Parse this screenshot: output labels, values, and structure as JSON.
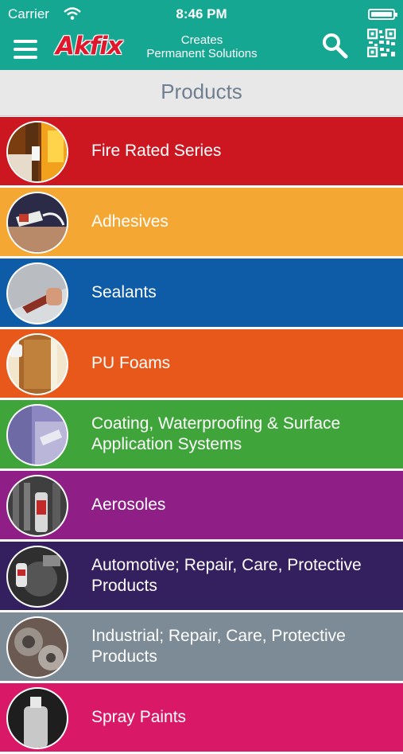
{
  "status_bar": {
    "carrier": "Carrier",
    "time": "8:46 PM"
  },
  "nav": {
    "logo_text": "Akfix",
    "tagline_line1": "Creates",
    "tagline_line2": "Permanent Solutions",
    "icons": [
      "hamburger-menu-icon",
      "search-icon",
      "qr-code-icon"
    ]
  },
  "page_title": "Products",
  "colors": {
    "accent": "#16a793",
    "title_text": "#6f7f8f"
  },
  "products": [
    {
      "label": "Fire Rated Series",
      "color": "#cc1620"
    },
    {
      "label": "Adhesives",
      "color": "#f5a733"
    },
    {
      "label": "Sealants",
      "color": "#0e5ba8"
    },
    {
      "label": "PU Foams",
      "color": "#e8581a"
    },
    {
      "label": "Coating, Waterproofing & Surface Application Systems",
      "color": "#3fa53a"
    },
    {
      "label": "Aerosoles",
      "color": "#8f1f86"
    },
    {
      "label": "Automotive; Repair, Care, Protective Products",
      "color": "#35205f"
    },
    {
      "label": "Industrial; Repair, Care, Protective Products",
      "color": "#7c8b95"
    },
    {
      "label": "Spray Paints",
      "color": "#d91967"
    }
  ]
}
